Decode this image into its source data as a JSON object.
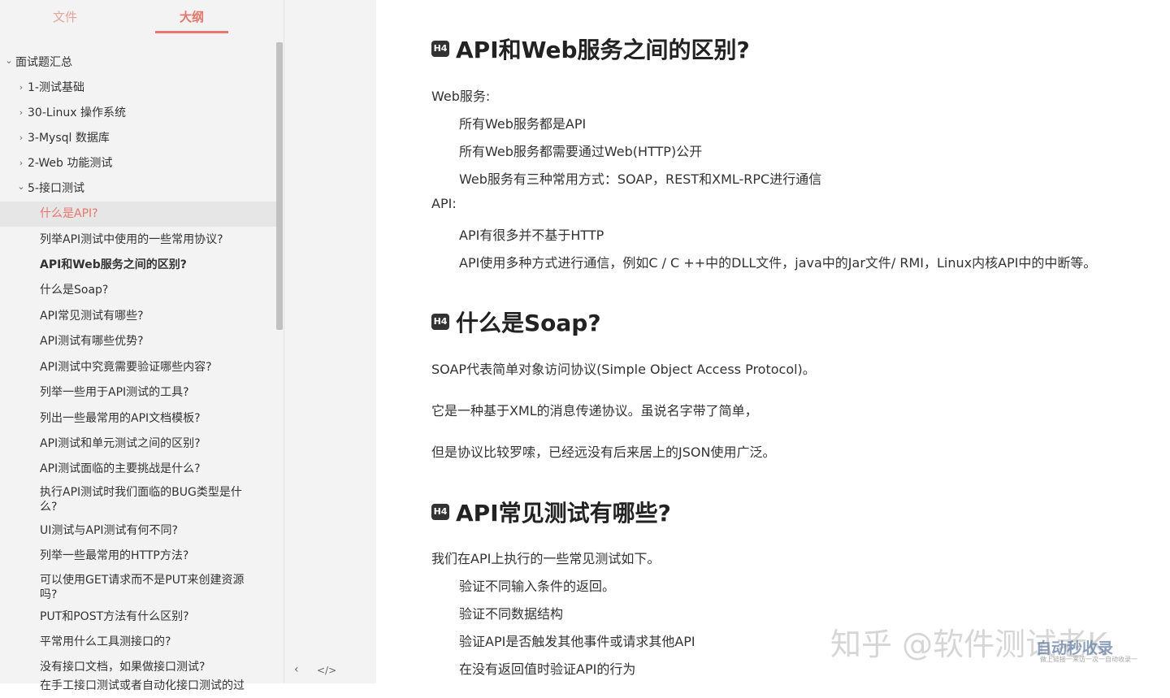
{
  "sidebar": {
    "tabs": [
      {
        "label": "文件"
      },
      {
        "label": "大纲"
      }
    ],
    "outline": [
      {
        "label": "面试题汇总",
        "level": 0,
        "chevron": "⌄"
      },
      {
        "label": "1-测试基础",
        "level": 1,
        "chevron": "›"
      },
      {
        "label": "30-Linux 操作系统",
        "level": 1,
        "chevron": "›"
      },
      {
        "label": "3-Mysql 数据库",
        "level": 1,
        "chevron": "›"
      },
      {
        "label": "2-Web 功能测试",
        "level": 1,
        "chevron": "›"
      },
      {
        "label": "5-接口测试",
        "level": 1,
        "chevron": "⌄"
      },
      {
        "label": "什么是API?",
        "level": 2,
        "state": "active"
      },
      {
        "label": "列举API测试中使用的一些常用协议?",
        "level": 2
      },
      {
        "label": "API和Web服务之间的区别?",
        "level": 2,
        "state": "bold"
      },
      {
        "label": "什么是Soap?",
        "level": 2
      },
      {
        "label": "API常见测试有哪些?",
        "level": 2
      },
      {
        "label": "API测试有哪些优势?",
        "level": 2
      },
      {
        "label": "API测试中究竟需要验证哪些内容?",
        "level": 2
      },
      {
        "label": "列举一些用于API测试的工具?",
        "level": 2
      },
      {
        "label": "列出一些最常用的API文档模板?",
        "level": 2
      },
      {
        "label": "API测试和单元测试之间的区别?",
        "level": 2
      },
      {
        "label": "API测试面临的主要挑战是什么?",
        "level": 2
      },
      {
        "label": "执行API测试时我们面临的BUG类型是什么?",
        "level": 2
      },
      {
        "label": "UI测试与API测试有何不同?",
        "level": 2
      },
      {
        "label": "列举一些最常用的HTTP方法?",
        "level": 2
      },
      {
        "label": "可以使用GET请求而不是PUT来创建资源吗?",
        "level": 2
      },
      {
        "label": "PUT和POST方法有什么区别?",
        "level": 2
      },
      {
        "label": "平常用什么工具测接口的?",
        "level": 2
      },
      {
        "label": "没有接口文档，如果做接口测试?",
        "level": 2
      },
      {
        "label": "在手工接口测试或者自动化接口测试的过",
        "level": 2
      }
    ],
    "footer": {
      "collapse_icon": "‹",
      "source_icon": "</>"
    }
  },
  "content": {
    "heading_badge": "H4",
    "sections": [
      {
        "heading": "API和Web服务之间的区别?",
        "paragraphs": [
          {
            "text": "Web服务:",
            "indent": 0
          },
          {
            "text": "所有Web服务都是API",
            "indent": 1
          },
          {
            "text": "所有Web服务都需要通过Web(HTTP)公开",
            "indent": 1
          },
          {
            "text": "Web服务有三种常用方式：SOAP，REST和XML-RPC进行通信",
            "indent": 1
          },
          {
            "text": "API:",
            "indent": 0
          },
          {
            "text": "API有很多并不基于HTTP",
            "indent": 1
          },
          {
            "text": "API使用多种方式进行通信，例如C / C ++中的DLL文件，java中的Jar文件/ RMI，Linux内核API中的中断等。",
            "indent": 1
          }
        ]
      },
      {
        "heading": "什么是Soap?",
        "paragraphs": [
          {
            "text": "SOAP代表简单对象访问协议(Simple Object Access Protocol)。",
            "indent": 0
          },
          {
            "text": "它是一种基于XML的消息传递协议。虽说名字带了简单，",
            "indent": 0
          },
          {
            "text": "但是协议比较罗嗦，已经远没有后来居上的JSON使用广泛。",
            "indent": 0
          }
        ]
      },
      {
        "heading": "API常见测试有哪些?",
        "paragraphs": [
          {
            "text": "我们在API上执行的一些常见测试如下。",
            "indent": 0
          },
          {
            "text": "验证不同输入条件的返回。",
            "indent": 1
          },
          {
            "text": "验证不同数据结构",
            "indent": 1
          },
          {
            "text": "验证API是否触发其他事件或请求其他API",
            "indent": 1
          },
          {
            "text": "在没有返回值时验证API的行为",
            "indent": 1
          }
        ]
      }
    ]
  },
  "watermark": {
    "text": "知乎 @软件测试老K",
    "logo": "自动秒收录",
    "sub": "做上链接一来访一次一自动收录一"
  }
}
